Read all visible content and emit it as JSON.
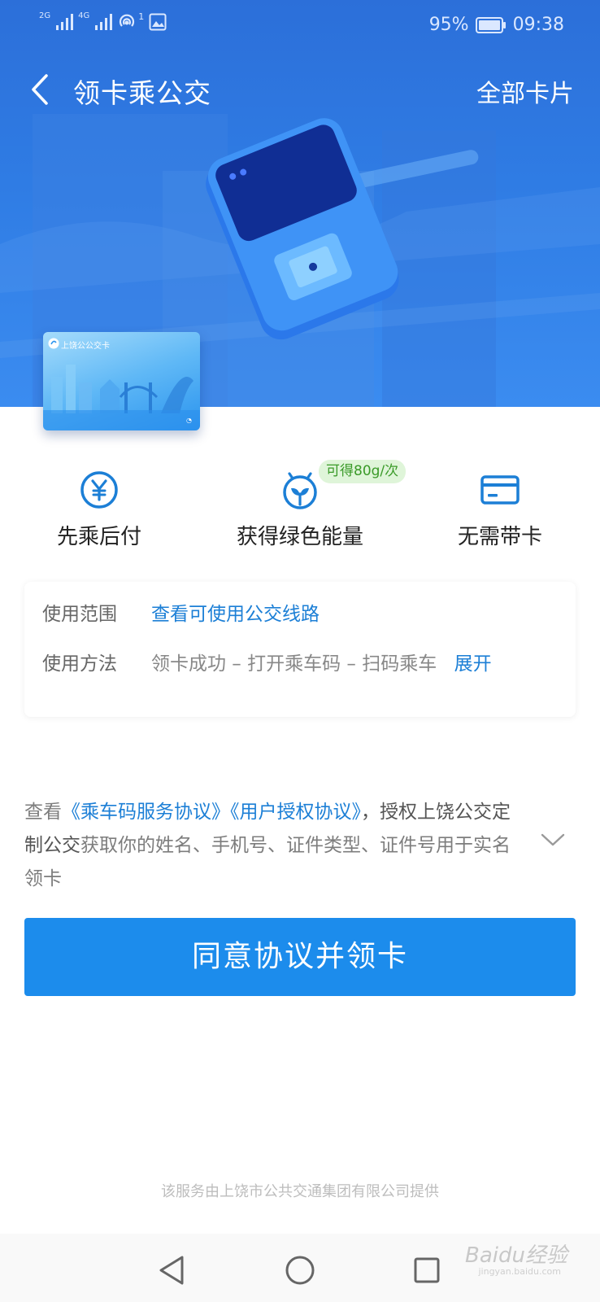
{
  "status_bar": {
    "network_1": "2G",
    "network_2": "4G",
    "sim_badge": "1",
    "battery": "95%",
    "time": "09:38"
  },
  "header": {
    "title": "领卡乘公交",
    "right_action": "全部卡片"
  },
  "hero": {
    "card_name": "上饶公公交卡"
  },
  "features": [
    {
      "label": "先乘后付",
      "icon": "yuan-coin-icon"
    },
    {
      "label": "获得绿色能量",
      "icon": "sprout-icon",
      "badge": "可得80g/次"
    },
    {
      "label": "无需带卡",
      "icon": "credit-card-icon"
    }
  ],
  "info": {
    "scope_label": "使用范围",
    "scope_link": "查看可使用公交线路",
    "method_label": "使用方法",
    "method_text": "领卡成功 – 打开乘车码 – 扫码乘车",
    "method_expand": "展开"
  },
  "agreement": {
    "prefix": "查看",
    "link1": "《乘车码服务协议》",
    "link2": "《用户授权协议》",
    "middle": "，授权",
    "org": "上饶公交定制公交",
    "suffix": "获取你的姓名、手机号、证件类型、证件号用于实名领卡"
  },
  "cta_label": "同意协议并领卡",
  "footer_note": "该服务由上饶市公共交通集团有限公司提供",
  "watermark": "Baidu经验",
  "watermark_sub": "jingyan.baidu.com",
  "colors": {
    "primary": "#1c8cec",
    "link": "#1c7fd6",
    "hero": "#2f7ce4",
    "badge_bg": "#dff5d9",
    "badge_text": "#3a9a28"
  }
}
